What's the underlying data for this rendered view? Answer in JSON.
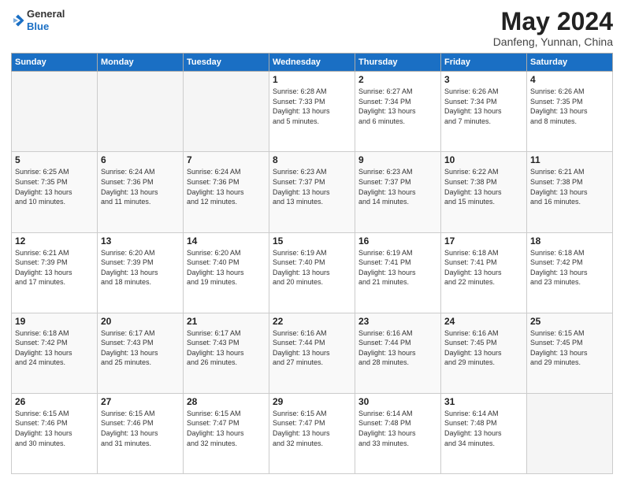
{
  "header": {
    "logo_general": "General",
    "logo_blue": "Blue",
    "month_title": "May 2024",
    "location": "Danfeng, Yunnan, China"
  },
  "days_of_week": [
    "Sunday",
    "Monday",
    "Tuesday",
    "Wednesday",
    "Thursday",
    "Friday",
    "Saturday"
  ],
  "weeks": [
    [
      {
        "day": "",
        "info": ""
      },
      {
        "day": "",
        "info": ""
      },
      {
        "day": "",
        "info": ""
      },
      {
        "day": "1",
        "info": "Sunrise: 6:28 AM\nSunset: 7:33 PM\nDaylight: 13 hours\nand 5 minutes."
      },
      {
        "day": "2",
        "info": "Sunrise: 6:27 AM\nSunset: 7:34 PM\nDaylight: 13 hours\nand 6 minutes."
      },
      {
        "day": "3",
        "info": "Sunrise: 6:26 AM\nSunset: 7:34 PM\nDaylight: 13 hours\nand 7 minutes."
      },
      {
        "day": "4",
        "info": "Sunrise: 6:26 AM\nSunset: 7:35 PM\nDaylight: 13 hours\nand 8 minutes."
      }
    ],
    [
      {
        "day": "5",
        "info": "Sunrise: 6:25 AM\nSunset: 7:35 PM\nDaylight: 13 hours\nand 10 minutes."
      },
      {
        "day": "6",
        "info": "Sunrise: 6:24 AM\nSunset: 7:36 PM\nDaylight: 13 hours\nand 11 minutes."
      },
      {
        "day": "7",
        "info": "Sunrise: 6:24 AM\nSunset: 7:36 PM\nDaylight: 13 hours\nand 12 minutes."
      },
      {
        "day": "8",
        "info": "Sunrise: 6:23 AM\nSunset: 7:37 PM\nDaylight: 13 hours\nand 13 minutes."
      },
      {
        "day": "9",
        "info": "Sunrise: 6:23 AM\nSunset: 7:37 PM\nDaylight: 13 hours\nand 14 minutes."
      },
      {
        "day": "10",
        "info": "Sunrise: 6:22 AM\nSunset: 7:38 PM\nDaylight: 13 hours\nand 15 minutes."
      },
      {
        "day": "11",
        "info": "Sunrise: 6:21 AM\nSunset: 7:38 PM\nDaylight: 13 hours\nand 16 minutes."
      }
    ],
    [
      {
        "day": "12",
        "info": "Sunrise: 6:21 AM\nSunset: 7:39 PM\nDaylight: 13 hours\nand 17 minutes."
      },
      {
        "day": "13",
        "info": "Sunrise: 6:20 AM\nSunset: 7:39 PM\nDaylight: 13 hours\nand 18 minutes."
      },
      {
        "day": "14",
        "info": "Sunrise: 6:20 AM\nSunset: 7:40 PM\nDaylight: 13 hours\nand 19 minutes."
      },
      {
        "day": "15",
        "info": "Sunrise: 6:19 AM\nSunset: 7:40 PM\nDaylight: 13 hours\nand 20 minutes."
      },
      {
        "day": "16",
        "info": "Sunrise: 6:19 AM\nSunset: 7:41 PM\nDaylight: 13 hours\nand 21 minutes."
      },
      {
        "day": "17",
        "info": "Sunrise: 6:18 AM\nSunset: 7:41 PM\nDaylight: 13 hours\nand 22 minutes."
      },
      {
        "day": "18",
        "info": "Sunrise: 6:18 AM\nSunset: 7:42 PM\nDaylight: 13 hours\nand 23 minutes."
      }
    ],
    [
      {
        "day": "19",
        "info": "Sunrise: 6:18 AM\nSunset: 7:42 PM\nDaylight: 13 hours\nand 24 minutes."
      },
      {
        "day": "20",
        "info": "Sunrise: 6:17 AM\nSunset: 7:43 PM\nDaylight: 13 hours\nand 25 minutes."
      },
      {
        "day": "21",
        "info": "Sunrise: 6:17 AM\nSunset: 7:43 PM\nDaylight: 13 hours\nand 26 minutes."
      },
      {
        "day": "22",
        "info": "Sunrise: 6:16 AM\nSunset: 7:44 PM\nDaylight: 13 hours\nand 27 minutes."
      },
      {
        "day": "23",
        "info": "Sunrise: 6:16 AM\nSunset: 7:44 PM\nDaylight: 13 hours\nand 28 minutes."
      },
      {
        "day": "24",
        "info": "Sunrise: 6:16 AM\nSunset: 7:45 PM\nDaylight: 13 hours\nand 29 minutes."
      },
      {
        "day": "25",
        "info": "Sunrise: 6:15 AM\nSunset: 7:45 PM\nDaylight: 13 hours\nand 29 minutes."
      }
    ],
    [
      {
        "day": "26",
        "info": "Sunrise: 6:15 AM\nSunset: 7:46 PM\nDaylight: 13 hours\nand 30 minutes."
      },
      {
        "day": "27",
        "info": "Sunrise: 6:15 AM\nSunset: 7:46 PM\nDaylight: 13 hours\nand 31 minutes."
      },
      {
        "day": "28",
        "info": "Sunrise: 6:15 AM\nSunset: 7:47 PM\nDaylight: 13 hours\nand 32 minutes."
      },
      {
        "day": "29",
        "info": "Sunrise: 6:15 AM\nSunset: 7:47 PM\nDaylight: 13 hours\nand 32 minutes."
      },
      {
        "day": "30",
        "info": "Sunrise: 6:14 AM\nSunset: 7:48 PM\nDaylight: 13 hours\nand 33 minutes."
      },
      {
        "day": "31",
        "info": "Sunrise: 6:14 AM\nSunset: 7:48 PM\nDaylight: 13 hours\nand 34 minutes."
      },
      {
        "day": "",
        "info": ""
      }
    ]
  ]
}
